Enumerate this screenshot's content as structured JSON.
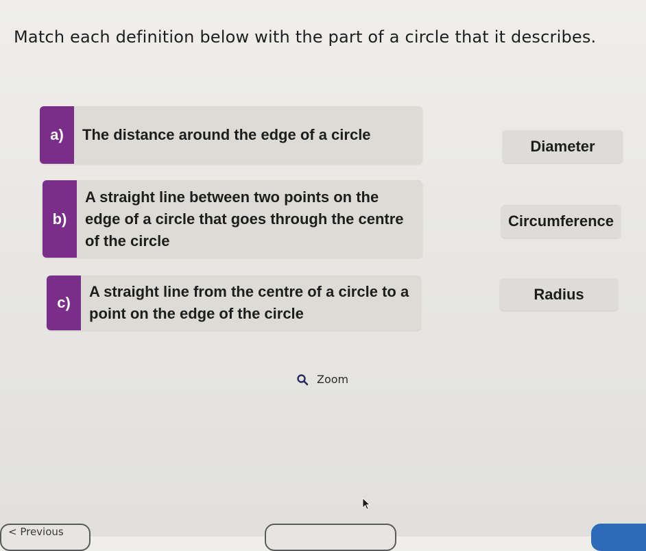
{
  "instruction": "Match each definition below with the part of a circle that it describes.",
  "definitions": [
    {
      "letter": "a)",
      "text": "The distance around the edge of a circle"
    },
    {
      "letter": "b)",
      "text": "A straight line between two points on the edge of a circle that goes through the centre of the circle"
    },
    {
      "letter": "c)",
      "text": "A straight line from the centre of a circle to a point on the edge of the circle"
    }
  ],
  "answers": [
    "Diameter",
    "Circumference",
    "Radius"
  ],
  "zoom": {
    "label": "Zoom",
    "icon": "magnifier-icon"
  },
  "navigation": {
    "previous_label": "< Previous"
  },
  "colors": {
    "letter_tab": "#7b2d8a",
    "next_button": "#2b6bb8"
  }
}
